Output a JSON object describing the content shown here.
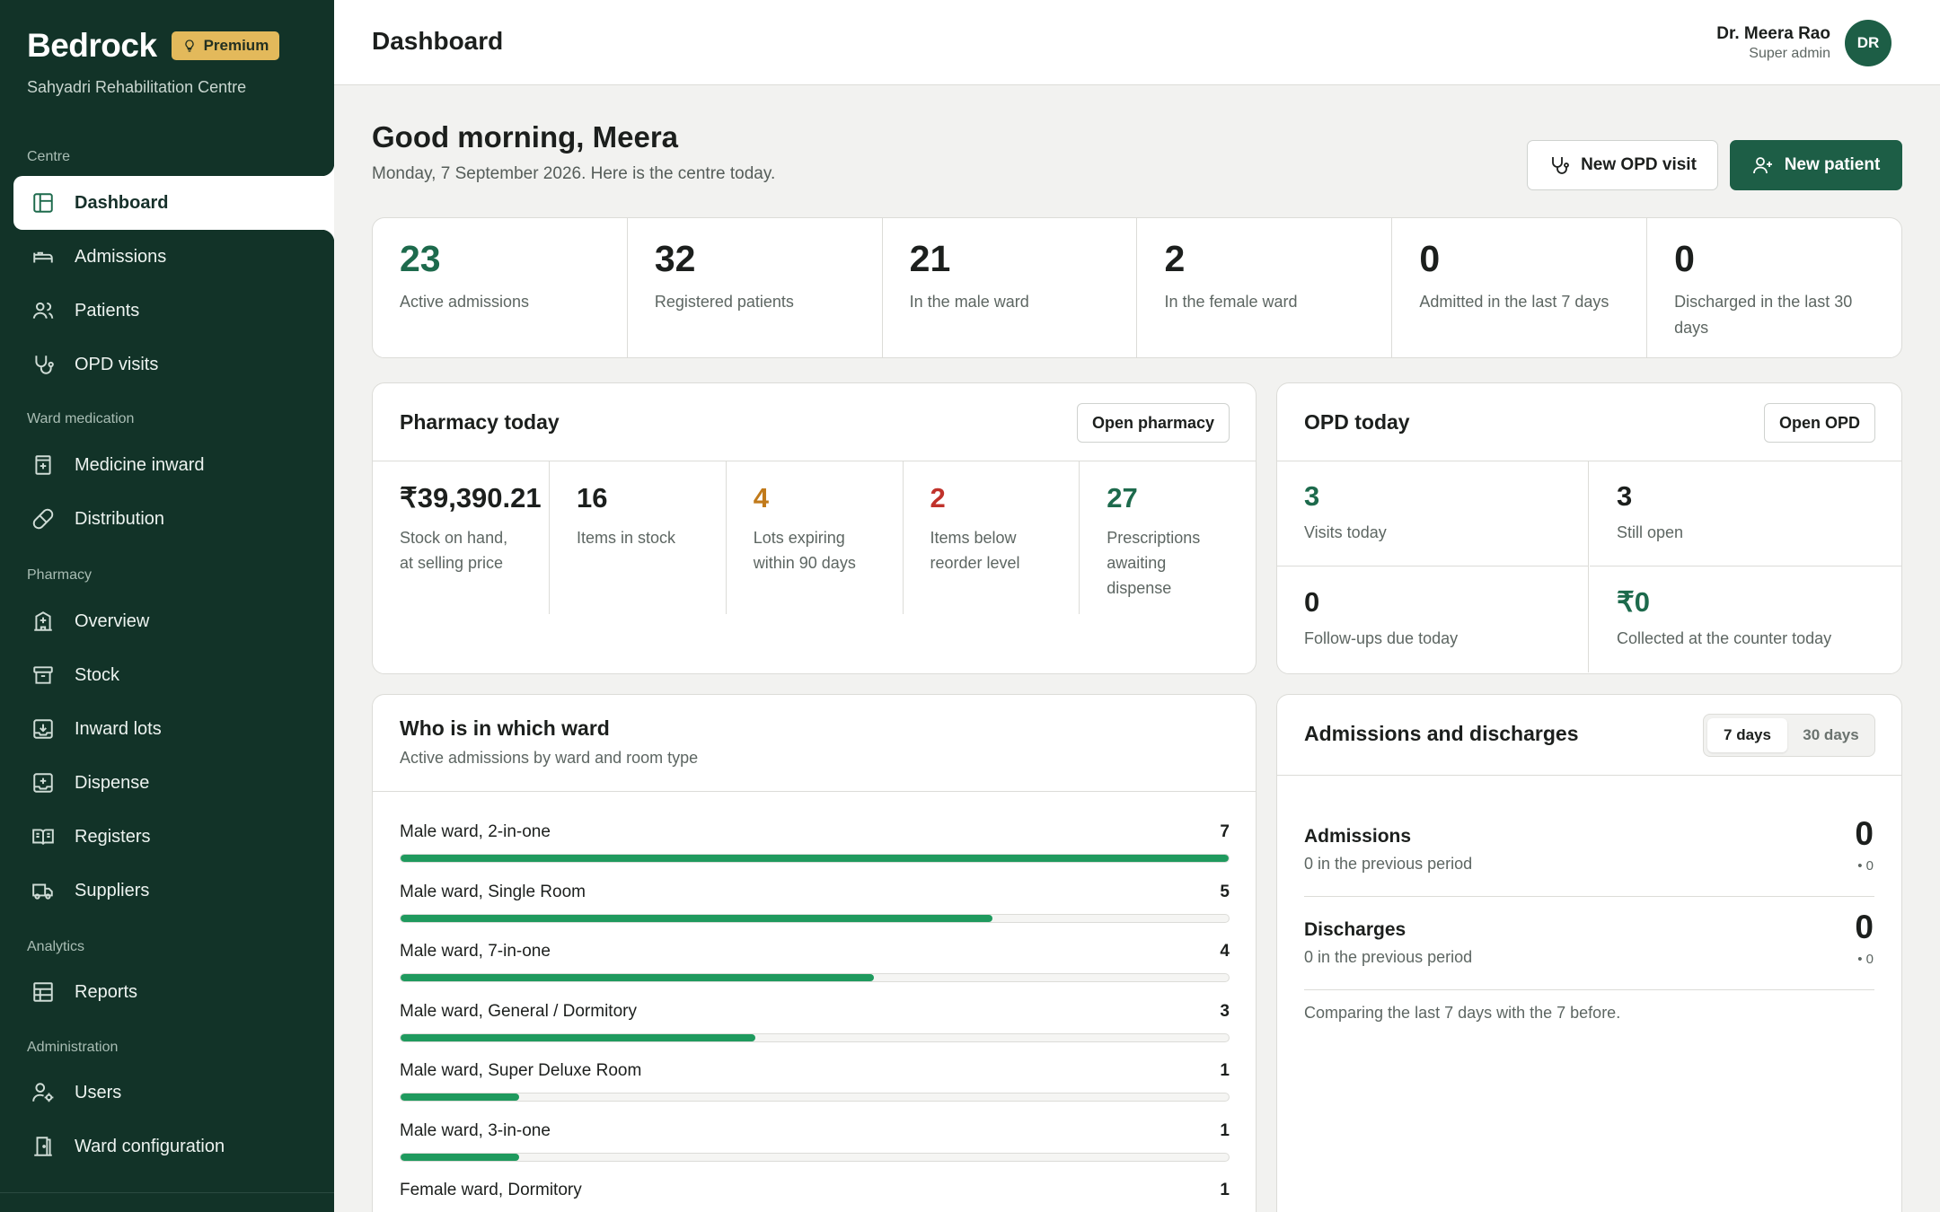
{
  "app": {
    "brand": "Bedrock",
    "badge": "Premium",
    "centre": "Sahyadri Rehabilitation Centre"
  },
  "nav": {
    "sections": {
      "centre": "Centre",
      "ward_medication": "Ward medication",
      "pharmacy": "Pharmacy",
      "analytics": "Analytics",
      "administration": "Administration"
    },
    "items": {
      "dashboard": "Dashboard",
      "admissions": "Admissions",
      "patients": "Patients",
      "opd_visits": "OPD visits",
      "medicine_inward": "Medicine inward",
      "distribution": "Distribution",
      "overview": "Overview",
      "stock": "Stock",
      "inward_lots": "Inward lots",
      "dispense": "Dispense",
      "registers": "Registers",
      "suppliers": "Suppliers",
      "reports": "Reports",
      "users": "Users",
      "ward_configuration": "Ward configuration"
    }
  },
  "header": {
    "title": "Dashboard",
    "user_name": "Dr. Meera Rao",
    "user_role": "Super admin",
    "avatar_initials": "DR"
  },
  "greeting": {
    "title": "Good morning, Meera",
    "subtitle": "Monday, 7 September 2026. Here is the centre today.",
    "new_opd_visit": "New OPD visit",
    "new_patient": "New patient"
  },
  "stats": [
    {
      "value": "23",
      "label": "Active admissions"
    },
    {
      "value": "32",
      "label": "Registered patients"
    },
    {
      "value": "21",
      "label": "In the male ward"
    },
    {
      "value": "2",
      "label": "In the female ward"
    },
    {
      "value": "0",
      "label": "Admitted in the last 7 days"
    },
    {
      "value": "0",
      "label": "Discharged in the last 30 days"
    }
  ],
  "pharmacy": {
    "title": "Pharmacy today",
    "button": "Open pharmacy",
    "cells": [
      {
        "value": "₹39,390.21",
        "label": "Stock on hand, at selling price"
      },
      {
        "value": "16",
        "label": "Items in stock"
      },
      {
        "value": "4",
        "label": "Lots expiring within 90 days"
      },
      {
        "value": "2",
        "label": "Items below reorder level"
      },
      {
        "value": "27",
        "label": "Prescriptions awaiting dispense"
      }
    ]
  },
  "opd": {
    "title": "OPD today",
    "button": "Open OPD",
    "cells": [
      {
        "value": "3",
        "label": "Visits today"
      },
      {
        "value": "3",
        "label": "Still open"
      },
      {
        "value": "0",
        "label": "Follow-ups due today"
      },
      {
        "value": "₹0",
        "label": "Collected at the counter today"
      }
    ]
  },
  "wards": {
    "title": "Who is in which ward",
    "subtitle": "Active admissions by ward and room type",
    "max": 7,
    "rows": [
      {
        "label": "Male ward, 2-in-one",
        "count": 7
      },
      {
        "label": "Male ward, Single Room",
        "count": 5
      },
      {
        "label": "Male ward, 7-in-one",
        "count": 4
      },
      {
        "label": "Male ward, General / Dormitory",
        "count": 3
      },
      {
        "label": "Male ward, Super Deluxe Room",
        "count": 1
      },
      {
        "label": "Male ward, 3-in-one",
        "count": 1
      },
      {
        "label": "Female ward, Dormitory",
        "count": 1
      }
    ]
  },
  "admissions_discharges": {
    "title": "Admissions and discharges",
    "toggle": [
      "7 days",
      "30 days"
    ],
    "rows": [
      {
        "label": "Admissions",
        "previous": "0 in the previous period",
        "value": "0",
        "delta": "• 0"
      },
      {
        "label": "Discharges",
        "previous": "0 in the previous period",
        "value": "0",
        "delta": "• 0"
      }
    ],
    "note": "Comparing the last 7 days with the 7 before."
  },
  "colors": {
    "sidebar": "#123328",
    "primary": "#1d5e46",
    "bar": "#1f9a5e",
    "premium": "#e3b95b",
    "amber": "#c17a1a",
    "red": "#c0322b"
  }
}
